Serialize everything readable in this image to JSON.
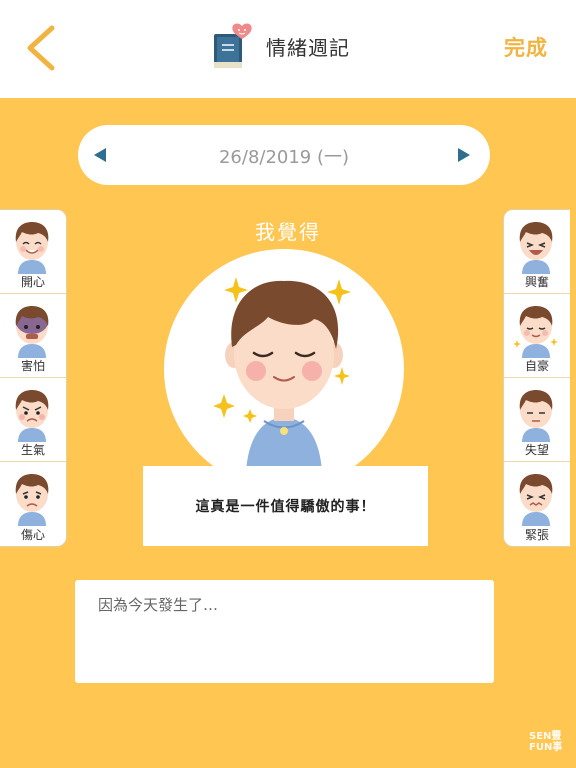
{
  "header": {
    "title": "情緒週記",
    "done_label": "完成",
    "back_icon": "chevron-left-icon",
    "book_icon": "heart-book-icon"
  },
  "date_bar": {
    "date_text": "26/8/2019 (一)"
  },
  "main": {
    "feel_label": "我覺得",
    "message": "這真是一件值得驕傲的事！",
    "note_placeholder": "因為今天發生了…"
  },
  "emotions_left": [
    {
      "label": "開心"
    },
    {
      "label": "害怕"
    },
    {
      "label": "生氣"
    },
    {
      "label": "傷心"
    }
  ],
  "emotions_right": [
    {
      "label": "興奮"
    },
    {
      "label": "自豪"
    },
    {
      "label": "失望"
    },
    {
      "label": "緊張"
    }
  ],
  "footer": {
    "logo_line1": "SEN豐",
    "logo_line2": "FUN事"
  },
  "colors": {
    "accent": "#FFC652",
    "done": "#F2B441",
    "arrow": "#2E6E8E"
  }
}
